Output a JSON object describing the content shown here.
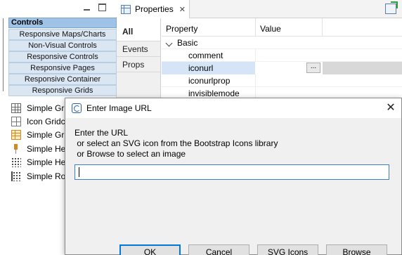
{
  "palette": {
    "controls_header": "Controls",
    "categories": [
      "Responsive Maps/Charts",
      "Non-Visual Controls",
      "Responsive Controls",
      "Responsive Pages",
      "Responsive Container",
      "Responsive Grids"
    ],
    "items": [
      {
        "label": "Simple Grid",
        "icon": "grid-icon"
      },
      {
        "label": "Icon Gridcol",
        "icon": "icon-grid-icon"
      },
      {
        "label": "Simple Grid",
        "icon": "colored-grid-icon"
      },
      {
        "label": "Simple Header",
        "icon": "header-icon"
      },
      {
        "label": "Simple Header",
        "icon": "dotted-header-icon"
      },
      {
        "label": "Simple Row",
        "icon": "row-icon"
      }
    ]
  },
  "properties": {
    "tab_label": "Properties",
    "tab_close": "✕",
    "side_tabs": [
      "All",
      "Events",
      "Props"
    ],
    "col_property": "Property",
    "col_value": "Value",
    "group": "Basic",
    "rows": [
      "comment",
      "iconurl",
      "iconurlprop",
      "invisiblemode"
    ],
    "ellipsis": "..."
  },
  "dialog": {
    "title": "Enter Image URL",
    "close": "✕",
    "instructions": [
      "Enter the URL",
      " or select an SVG icon from the Bootstrap Icons library",
      " or Browse to select an image"
    ],
    "url_value": "",
    "buttons": {
      "ok": "OK",
      "cancel": "Cancel",
      "svg": "SVG Icons",
      "browse": "Browse"
    }
  },
  "colors": {
    "accent": "#0078d7",
    "controls_header": "#9ec3e6",
    "category_bg": "#dbe6f3",
    "selected_row": "#d5e5f7"
  }
}
